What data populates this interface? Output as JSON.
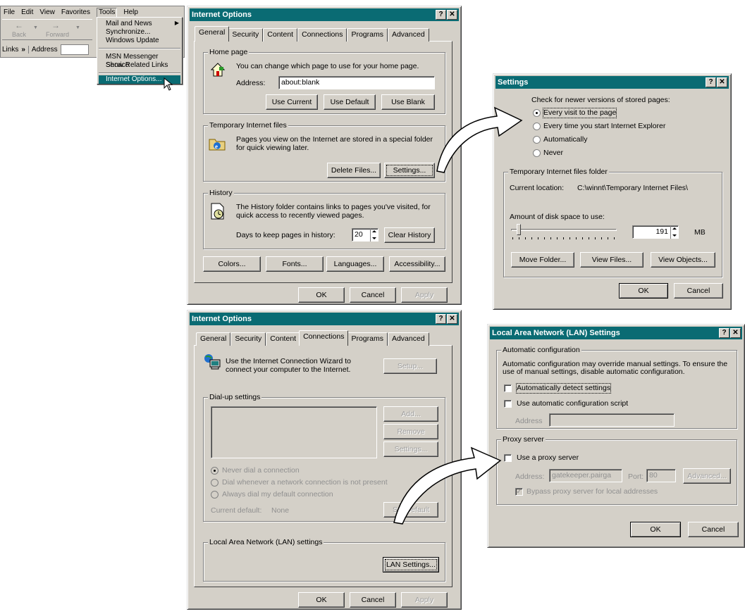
{
  "browser": {
    "menu": [
      "File",
      "Edit",
      "View",
      "Favorites",
      "Tools",
      "Help"
    ],
    "back": "Back",
    "forward": "Forward",
    "links": "Links",
    "chev": "»",
    "address": "Address"
  },
  "tools_menu": {
    "items": [
      "Mail and News",
      "Synchronize...",
      "Windows Update",
      "MSN Messenger Service",
      "Show Related Links",
      "Internet Options..."
    ]
  },
  "io1": {
    "title": "Internet Options",
    "tabs": [
      "General",
      "Security",
      "Content",
      "Connections",
      "Programs",
      "Advanced"
    ],
    "home": {
      "label": "Home page",
      "text": "You can change which page to use for your home page.",
      "addr_label": "Address:",
      "addr": "about:blank",
      "b1": "Use Current",
      "b2": "Use Default",
      "b3": "Use Blank"
    },
    "temp": {
      "label": "Temporary Internet files",
      "text1": "Pages you view on the Internet are stored in a special folder",
      "text2": "for quick viewing later.",
      "b1": "Delete Files...",
      "b2": "Settings..."
    },
    "hist": {
      "label": "History",
      "text1": "The History folder contains links to pages you've visited, for",
      "text2": "quick access to recently viewed pages.",
      "days_label": "Days to keep pages in history:",
      "days": "20",
      "b1": "Clear History"
    },
    "b": [
      "Colors...",
      "Fonts...",
      "Languages...",
      "Accessibility..."
    ],
    "ok": "OK",
    "cancel": "Cancel",
    "apply": "Apply"
  },
  "settings": {
    "title": "Settings",
    "check": "Check for newer versions of stored pages:",
    "r": [
      "Every visit to the page",
      "Every time you start Internet Explorer",
      "Automatically",
      "Never"
    ],
    "folder": "Temporary Internet files folder",
    "cur_label": "Current location:",
    "cur": "C:\\winnt\\Temporary Internet Files\\",
    "disk": "Amount of disk space to use:",
    "mb_val": "191",
    "mb": "MB",
    "b": [
      "Move Folder...",
      "View Files...",
      "View Objects..."
    ],
    "ok": "OK",
    "cancel": "Cancel"
  },
  "io2": {
    "title": "Internet Options",
    "tabs": [
      "General",
      "Security",
      "Content",
      "Connections",
      "Programs",
      "Advanced"
    ],
    "wiz1": "Use the Internet Connection Wizard to",
    "wiz2": "connect your computer to the Internet.",
    "setup": "Setup...",
    "dial": "Dial-up settings",
    "add": "Add...",
    "remove": "Remove",
    "settings": "Settings...",
    "r": [
      "Never dial a connection",
      "Dial whenever a network connection is not present",
      "Always dial my default connection"
    ],
    "cur_label": "Current default:",
    "cur": "None",
    "setdef": "Set Default",
    "lan": "Local Area Network (LAN) settings",
    "lanbtn": "LAN Settings...",
    "ok": "OK",
    "cancel": "Cancel",
    "apply": "Apply"
  },
  "lan": {
    "title": "Local Area Network (LAN) Settings",
    "auto": "Automatic configuration",
    "auto1": "Automatic configuration may override manual settings.  To ensure the",
    "auto2": "use of manual settings, disable automatic configuration.",
    "c1": "Automatically detect settings",
    "c2": "Use automatic configuration script",
    "addr": "Address",
    "proxy": "Proxy server",
    "c3": "Use a proxy server",
    "paddr": "Address:",
    "pval": "gatekeeper.pairga",
    "port": "Port:",
    "portv": "80",
    "adv": "Advanced...",
    "bypass": "Bypass proxy server for local addresses",
    "ok": "OK",
    "cancel": "Cancel"
  }
}
